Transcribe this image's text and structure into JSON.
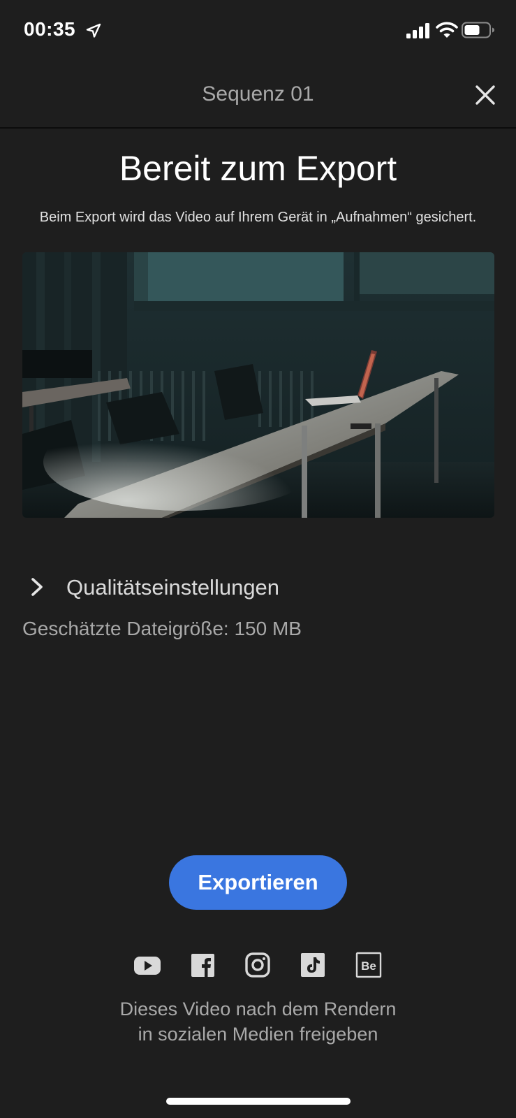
{
  "status_bar": {
    "time": "00:35",
    "icons": [
      "location-arrow-icon",
      "cellular-signal-icon",
      "wifi-icon",
      "battery-icon"
    ]
  },
  "header": {
    "title": "Sequenz 01",
    "close_icon": "close-icon"
  },
  "main": {
    "title": "Bereit zum Export",
    "subtitle": "Beim Export wird das Video auf Ihrem Gerät in „Aufnahmen“ gesichert.",
    "preview_image": "video-thumbnail-conference-room"
  },
  "quality": {
    "label": "Qualitätseinstellungen",
    "expanded": false
  },
  "file_size": {
    "text": "Geschätzte Dateigröße: 150 MB"
  },
  "export_button": {
    "label": "Exportieren"
  },
  "social": {
    "platforms": [
      "youtube-icon",
      "facebook-icon",
      "instagram-icon",
      "tiktok-icon",
      "behance-icon"
    ],
    "behance_text": "Be",
    "share_line1": "Dieses Video nach dem Rendern",
    "share_line2": "in sozialen Medien freigeben"
  },
  "colors": {
    "background": "#1e1e1e",
    "accent": "#3a76e0",
    "secondary_text": "#a9a9a9"
  }
}
